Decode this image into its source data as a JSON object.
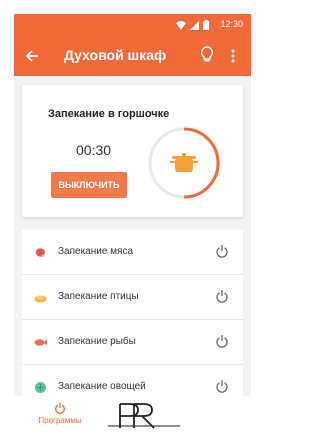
{
  "status_bar": {
    "time": "12:30",
    "icons": [
      "wifi-icon",
      "signal-icon",
      "battery-icon"
    ]
  },
  "app_bar": {
    "title": "Духовой шкаф",
    "icons": [
      "back-arrow-icon",
      "lightbulb-icon",
      "more-vert-icon"
    ]
  },
  "active_program": {
    "title": "Запекание в горшочке",
    "timer": "00:30",
    "button_label": "ВЫКЛЮЧИТЬ",
    "icon": "pot-icon"
  },
  "programs": [
    {
      "label": "Запекание мяса",
      "icon": "meat-icon"
    },
    {
      "label": "Запекание птицы",
      "icon": "poultry-icon"
    },
    {
      "label": "Запекание рыбы",
      "icon": "fish-icon"
    },
    {
      "label": "Запекание овощей",
      "icon": "vegetables-icon"
    }
  ],
  "bottom_nav": {
    "tab_label": "Программы",
    "icon": "power-icon"
  },
  "colors": {
    "accent": "#f26a3a",
    "button": "#f27a4a",
    "pot": "#f2a13a",
    "meat": "#e2574c",
    "poultry": "#f0b640",
    "fish": "#ee6a5a",
    "vegetables": "#5bbfa0"
  }
}
